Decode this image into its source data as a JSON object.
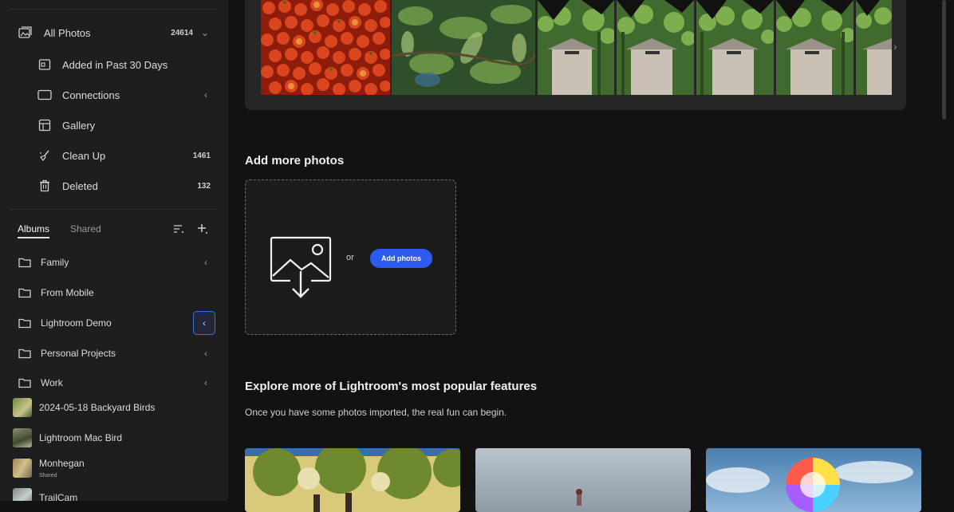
{
  "sidebar": {
    "all_photos": {
      "label": "All Photos",
      "count": "24614"
    },
    "items": [
      {
        "label": "Added in Past 30 Days",
        "count": ""
      },
      {
        "label": "Connections",
        "count": ""
      },
      {
        "label": "Gallery",
        "count": ""
      },
      {
        "label": "Clean Up",
        "count": "1461"
      },
      {
        "label": "Deleted",
        "count": "132"
      }
    ],
    "tabs": {
      "albums": "Albums",
      "shared": "Shared"
    },
    "albums": [
      {
        "label": "Family"
      },
      {
        "label": "From Mobile"
      },
      {
        "label": "Lightroom Demo"
      },
      {
        "label": "Personal Projects"
      },
      {
        "label": "Work"
      }
    ],
    "photo_albums": [
      {
        "label": "2024-05-18 Backyard Birds",
        "sub": ""
      },
      {
        "label": "Lightroom Mac Bird",
        "sub": ""
      },
      {
        "label": "Monhegan",
        "sub": "Shared"
      },
      {
        "label": "TrailCam",
        "sub": ""
      }
    ]
  },
  "main": {
    "add_more": {
      "title": "Add more photos",
      "or": "or",
      "button": "Add photos"
    },
    "explore": {
      "title": "Explore more of Lightroom's most popular features",
      "subtitle": "Once you have some photos imported, the real fun can begin."
    }
  },
  "colors": {
    "background": "#121212",
    "sidebar": "#1e1e1e",
    "accent": "#2d5bf0"
  },
  "icons": {
    "all_photos": "photos-icon",
    "collapse": "chevron-down-icon",
    "expand": "chevron-left-icon",
    "folder": "folder-icon",
    "upload": "image-upload-icon"
  }
}
